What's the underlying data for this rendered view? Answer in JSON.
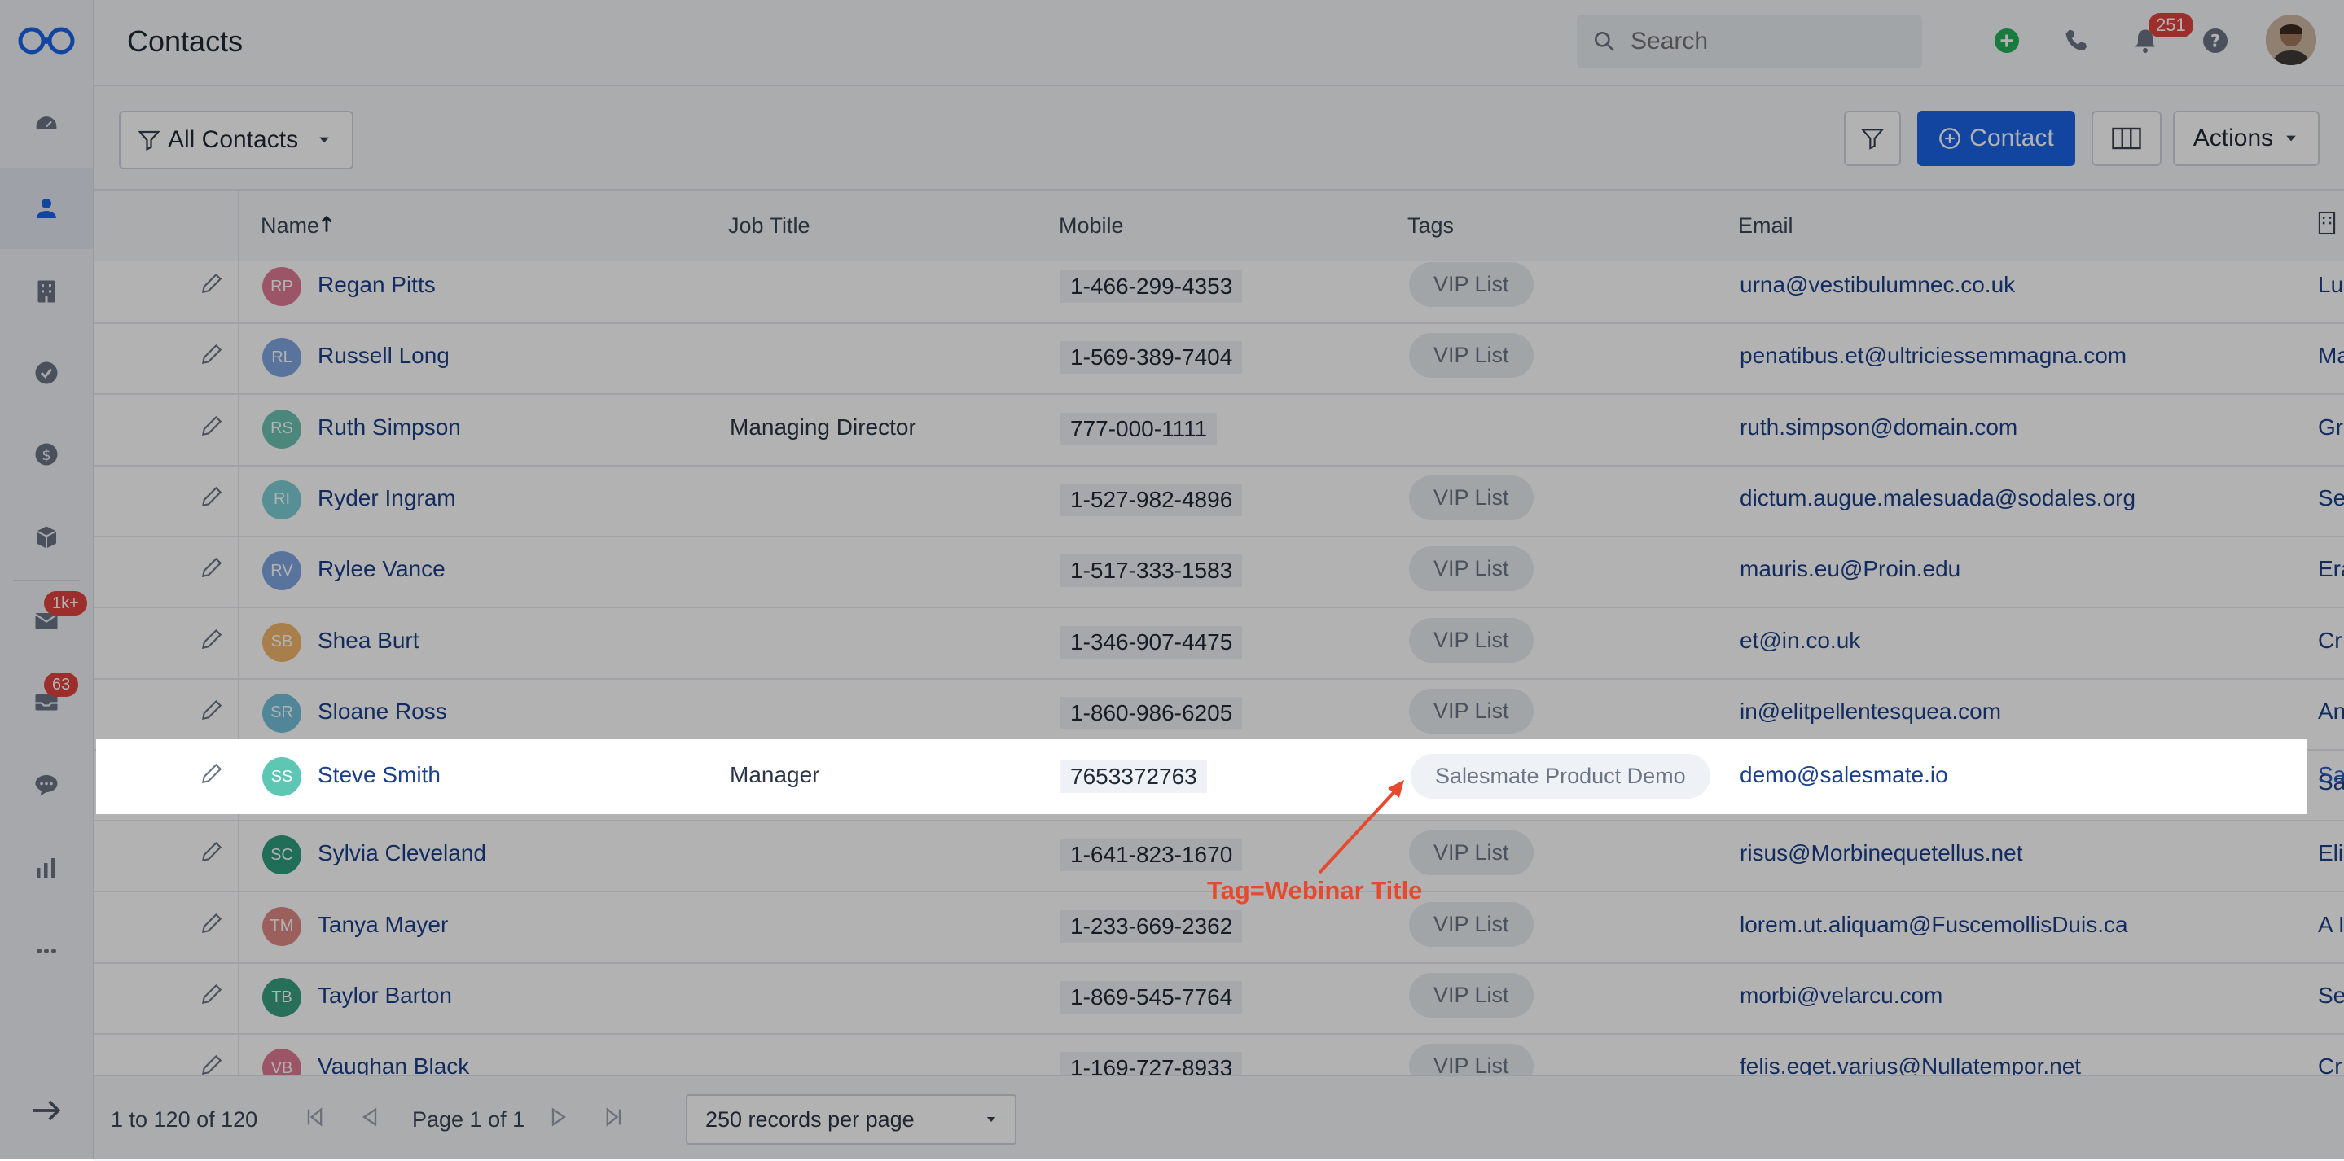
{
  "app": {
    "page_title": "Contacts",
    "search_placeholder": "Search",
    "notification_count": "251"
  },
  "sidebar": {
    "items": [
      {
        "icon": "dashboard-icon"
      },
      {
        "icon": "contacts-icon"
      },
      {
        "icon": "companies-icon"
      },
      {
        "icon": "tasks-icon"
      },
      {
        "icon": "deals-icon"
      },
      {
        "icon": "products-icon"
      },
      {
        "icon": "email-icon",
        "badge": "1k+"
      },
      {
        "icon": "inbox-icon",
        "badge": "63"
      },
      {
        "icon": "chat-icon"
      },
      {
        "icon": "reports-icon"
      },
      {
        "icon": "more-icon"
      }
    ]
  },
  "toolbar": {
    "view_label": "All Contacts",
    "add_contact_label": "Contact",
    "actions_label": "Actions"
  },
  "table": {
    "columns": [
      "Name",
      "Job Title",
      "Mobile",
      "Tags",
      "Email"
    ],
    "rows": [
      {
        "initials": "RP",
        "color": "#e07a93",
        "name": "Regan Pitts",
        "job": "",
        "mobile": "1-466-299-4353",
        "tag": "VIP List",
        "email": "urna@vestibulumnec.co.uk",
        "extra": "Lu"
      },
      {
        "initials": "RL",
        "color": "#7fa6e0",
        "name": "Russell Long",
        "job": "",
        "mobile": "1-569-389-7404",
        "tag": "VIP List",
        "email": "penatibus.et@ultriciessemmagna.com",
        "extra": "Ma"
      },
      {
        "initials": "RS",
        "color": "#6cc2b1",
        "name": "Ruth Simpson",
        "job": "Managing Director",
        "mobile": "777-000-1111",
        "tag": "",
        "email": "ruth.simpson@domain.com",
        "extra": "Gr"
      },
      {
        "initials": "RI",
        "color": "#7ccfd4",
        "name": "Ryder Ingram",
        "job": "",
        "mobile": "1-527-982-4896",
        "tag": "VIP List",
        "email": "dictum.augue.malesuada@sodales.org",
        "extra": "Se"
      },
      {
        "initials": "RV",
        "color": "#7fa6e0",
        "name": "Rylee Vance",
        "job": "",
        "mobile": "1-517-333-1583",
        "tag": "VIP List",
        "email": "mauris.eu@Proin.edu",
        "extra": "Era"
      },
      {
        "initials": "SB",
        "color": "#f1b66a",
        "name": "Shea Burt",
        "job": "",
        "mobile": "1-346-907-4475",
        "tag": "VIP List",
        "email": "et@in.co.uk",
        "extra": "Cr"
      },
      {
        "initials": "SR",
        "color": "#73c1d9",
        "name": "Sloane Ross",
        "job": "",
        "mobile": "1-860-986-6205",
        "tag": "VIP List",
        "email": "in@elitpellentesquea.com",
        "extra": "An"
      },
      {
        "initials": "SS",
        "color": "#5ec7b3",
        "name": "Steve Smith",
        "job": "Manager",
        "mobile": "7653372763",
        "tag": "Salesmate Product Demo",
        "email": "demo@salesmate.io",
        "extra": "Sa"
      },
      {
        "initials": "SC",
        "color": "#2e9e7e",
        "name": "Sylvia Cleveland",
        "job": "",
        "mobile": "1-641-823-1670",
        "tag": "VIP List",
        "email": "risus@Morbinequetellus.net",
        "extra": "Eli"
      },
      {
        "initials": "TM",
        "color": "#e08a84",
        "name": "Tanya Mayer",
        "job": "",
        "mobile": "1-233-669-2362",
        "tag": "VIP List",
        "email": "lorem.ut.aliquam@FuscemollisDuis.ca",
        "extra": "A I"
      },
      {
        "initials": "TB",
        "color": "#3aa082",
        "name": "Taylor Barton",
        "job": "",
        "mobile": "1-869-545-7764",
        "tag": "VIP List",
        "email": "morbi@velarcu.com",
        "extra": "Se"
      },
      {
        "initials": "VB",
        "color": "#e07a93",
        "name": "Vaughan Black",
        "job": "",
        "mobile": "1-169-727-8933",
        "tag": "VIP List",
        "email": "felis.eget.varius@Nullatempor.net",
        "extra": "Cr"
      }
    ]
  },
  "footer": {
    "range": "1 to 120 of 120",
    "page": "Page 1 of 1",
    "per_page": "250 records per page"
  },
  "annotation": {
    "text": "Tag=Webinar Title"
  }
}
